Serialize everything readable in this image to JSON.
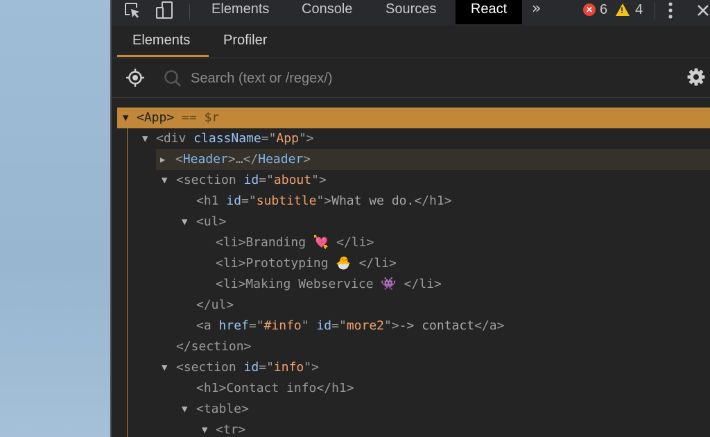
{
  "toolbar": {
    "tabs": [
      "Elements",
      "Console",
      "Sources",
      "React"
    ],
    "active_tab": "React",
    "overflow_label": "»",
    "error_count": "6",
    "warning_count": "4"
  },
  "react_tabs": {
    "items": [
      "Elements",
      "Profiler"
    ],
    "active": "Elements"
  },
  "search": {
    "placeholder": "Search (text or /regex/)"
  },
  "colors": {
    "accent": "#c08838",
    "background": "#242424",
    "attr": "#9ac3f5",
    "value": "#f0a16e",
    "component": "#7fb6e8"
  },
  "tree": {
    "r0": {
      "open": "<App>",
      "suffix": " == $r"
    },
    "r1": {
      "open": "<div ",
      "attr": "className",
      "eq": "=\"",
      "val": "App",
      "close": "\">"
    },
    "r2": {
      "lt": "<",
      "name": "Header",
      "mid": ">…</",
      "name2": "Header",
      "gt": ">"
    },
    "r3": {
      "open": "<section ",
      "attr": "id",
      "eq": "=\"",
      "val": "about",
      "close": "\">"
    },
    "r4": {
      "open": "<h1 ",
      "attr": "id",
      "eq": "=\"",
      "val": "subtitle",
      "close": "\">",
      "text": "What we do.",
      "end": "</h1>"
    },
    "r5": {
      "open": "<ul>"
    },
    "r6": {
      "text": "<li>Branding 💘 </li>"
    },
    "r7": {
      "text": "<li>Prototyping 🐣 </li>"
    },
    "r8": {
      "text": "<li>Making Webservice 👾 </li>"
    },
    "r9": {
      "text": "</ul>"
    },
    "r10": {
      "open": "<a ",
      "attr": "href",
      "eq": "=\"",
      "val": "#info",
      "q": "\" ",
      "attr2": "id",
      "eq2": "=\"",
      "val2": "more2",
      "close": "\">",
      "text": "-> contact",
      "end": "</a>"
    },
    "r11": {
      "text": "</section>"
    },
    "r12": {
      "open": "<section ",
      "attr": "id",
      "eq": "=\"",
      "val": "info",
      "close": "\">"
    },
    "r13": {
      "text": "<h1>Contact info</h1>"
    },
    "r14": {
      "open": "<table>"
    },
    "r15": {
      "open": "<tr>"
    }
  }
}
